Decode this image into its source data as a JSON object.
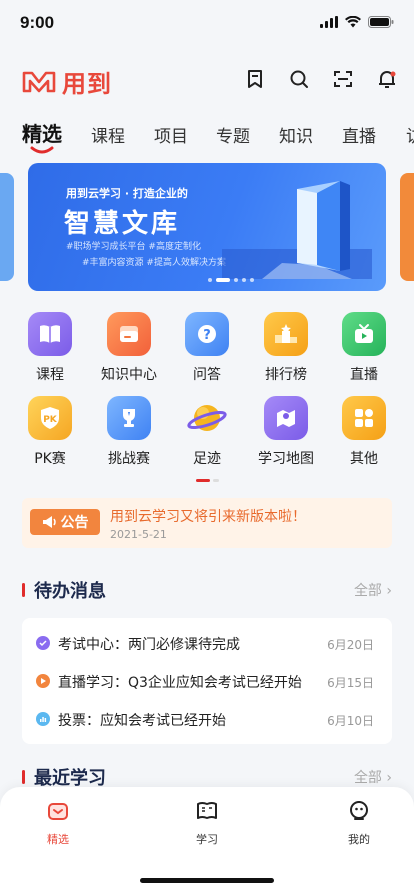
{
  "status_bar": {
    "time": "9:00"
  },
  "header": {
    "brand": "用到",
    "icons": [
      "bookmark-icon",
      "search-icon",
      "scan-icon",
      "bell-icon"
    ]
  },
  "tabs": [
    "精选",
    "课程",
    "项目",
    "专题",
    "知识",
    "直播",
    "访"
  ],
  "banner": {
    "subtitle": "用到云学习 · 打造企业的",
    "title": "智慧文库",
    "tag_line_1": "#职场学习成长平台  #高度定制化",
    "tag_line_2": "#丰富内容资源  #提高人效解决方案"
  },
  "grid": [
    {
      "label": "课程",
      "icon": "book-icon",
      "color": "#8a6cf0"
    },
    {
      "label": "知识中心",
      "icon": "folder-icon",
      "color": "#f2753e"
    },
    {
      "label": "问答",
      "icon": "question-icon",
      "color": "#4a8ff5"
    },
    {
      "label": "排行榜",
      "icon": "podium-icon",
      "color": "#f5a623"
    },
    {
      "label": "直播",
      "icon": "tv-icon",
      "color": "#3cc46a"
    },
    {
      "label": "PK赛",
      "icon": "pk-shield-icon",
      "color": "#f5b82e"
    },
    {
      "label": "挑战赛",
      "icon": "trophy-icon",
      "color": "#4a8ff5"
    },
    {
      "label": "足迹",
      "icon": "planet-icon",
      "color": "#f5a623"
    },
    {
      "label": "学习地图",
      "icon": "map-icon",
      "color": "#8a6cf0"
    },
    {
      "label": "其他",
      "icon": "apps-icon",
      "color": "#f5a623"
    }
  ],
  "notice": {
    "badge": "公告",
    "text": "用到云学习又将引来新版本啦！",
    "date": "2021-5-21"
  },
  "todo": {
    "title": "待办消息",
    "more": "全部",
    "items": [
      {
        "text": "考试中心：两门必修课待完成",
        "date": "6月20日",
        "color": "#8a6cf0"
      },
      {
        "text": "直播学习：Q3企业应知会考试已经开始",
        "date": "6月15日",
        "color": "#f2853e"
      },
      {
        "text": "投票：应知会考试已经开始",
        "date": "6月10日",
        "color": "#5bb8f0"
      }
    ]
  },
  "recent": {
    "title": "最近学习",
    "more": "全部"
  },
  "tabbar": [
    {
      "label": "精选",
      "active": true
    },
    {
      "label": "学习",
      "active": false
    },
    {
      "label": "我的",
      "active": false
    }
  ]
}
